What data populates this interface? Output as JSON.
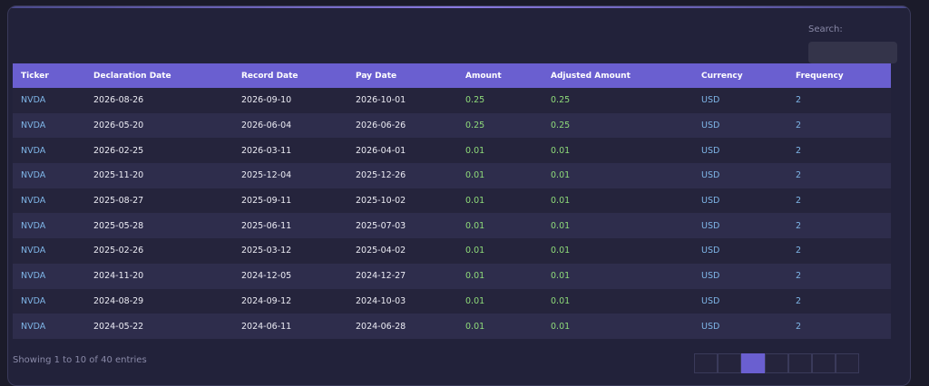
{
  "search": {
    "label": "Search:",
    "placeholder": "",
    "value": ""
  },
  "table": {
    "headers": [
      "Ticker",
      "Declaration Date",
      "Record Date",
      "Pay Date",
      "Amount",
      "Adjusted Amount",
      "Currency",
      "Frequency"
    ],
    "rows": [
      [
        "NVDA",
        "2026-08-26",
        "2026-09-10",
        "2026-10-01",
        "0.25",
        "0.25",
        "USD",
        "2"
      ],
      [
        "NVDA",
        "2026-05-20",
        "2026-06-04",
        "2026-06-26",
        "0.25",
        "0.25",
        "USD",
        "2"
      ],
      [
        "NVDA",
        "2026-02-25",
        "2026-03-11",
        "2026-04-01",
        "0.01",
        "0.01",
        "USD",
        "2"
      ],
      [
        "NVDA",
        "2025-11-20",
        "2025-12-04",
        "2025-12-26",
        "0.01",
        "0.01",
        "USD",
        "2"
      ],
      [
        "NVDA",
        "2025-08-27",
        "2025-09-11",
        "2025-10-02",
        "0.01",
        "0.01",
        "USD",
        "2"
      ],
      [
        "NVDA",
        "2025-05-28",
        "2025-06-11",
        "2025-07-03",
        "0.01",
        "0.01",
        "USD",
        "2"
      ],
      [
        "NVDA",
        "2025-02-26",
        "2025-03-12",
        "2025-04-02",
        "0.01",
        "0.01",
        "USD",
        "2"
      ],
      [
        "NVDA",
        "2024-11-20",
        "2024-12-05",
        "2024-12-27",
        "0.01",
        "0.01",
        "USD",
        "2"
      ],
      [
        "NVDA",
        "2024-08-29",
        "2024-09-12",
        "2024-10-03",
        "0.01",
        "0.01",
        "USD",
        "2"
      ],
      [
        "NVDA",
        "2024-05-22",
        "2024-06-11",
        "2024-06-28",
        "0.01",
        "0.01",
        "USD",
        "2"
      ]
    ]
  },
  "footer": {
    "info": "Showing 1 to 10 of 40 entries"
  },
  "colors": {
    "header_bg": "#6a5fd0",
    "link": "#7fb6e8",
    "amount": "#8fdc7a"
  }
}
